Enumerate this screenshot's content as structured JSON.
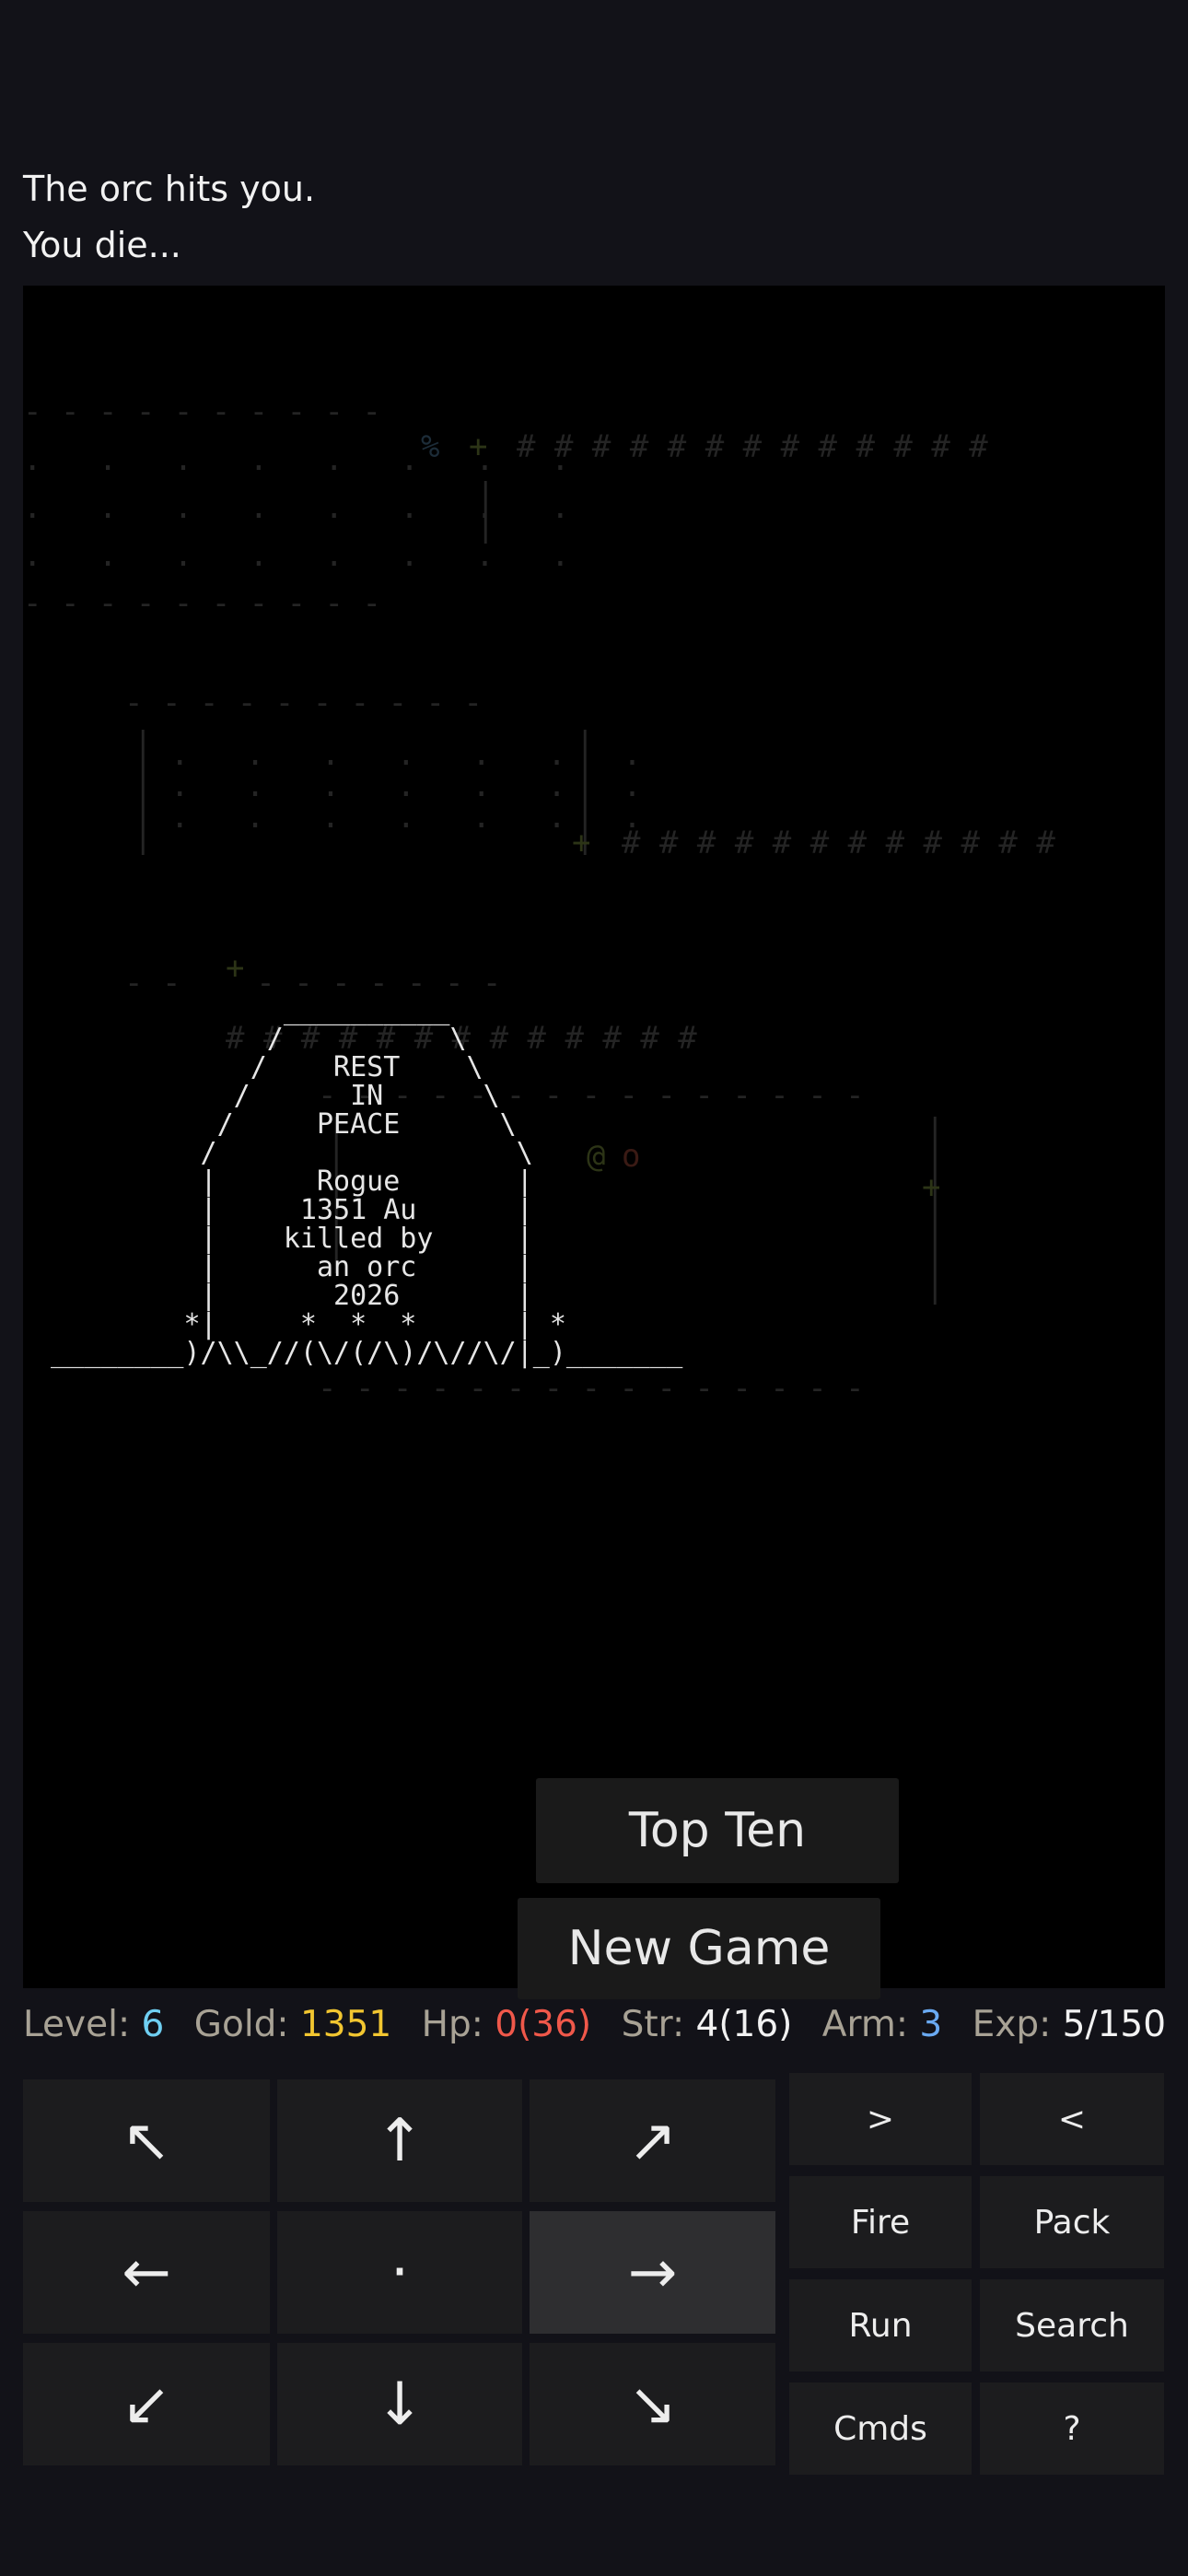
{
  "messages": [
    "The orc hits you.",
    "You die..."
  ],
  "tombstone": {
    "lines": [
      "              __________",
      "             /          \\",
      "            /    REST    \\",
      "           /      IN      \\",
      "          /     PEACE      \\",
      "         /                  \\",
      "         |      Rogue       |",
      "         |     1351 Au      |",
      "         |    killed by     |",
      "         |      an orc      |",
      "         |       2026       |",
      "        *|     *  *  *      | *",
      "________)/\\\\_//(\\/(/\\)/\\//\\/|_)_______"
    ]
  },
  "map_glyphs": {
    "gold_symbol": "%",
    "player_symbol": "@",
    "monster_symbol": "o"
  },
  "buttons": {
    "top_ten": "Top Ten",
    "new_game": "New Game"
  },
  "status": {
    "level_label": "Level:",
    "level_value": "6",
    "gold_label": "Gold:",
    "gold_value": "1351",
    "hp_label": "Hp:",
    "hp_value": "0(36)",
    "str_label": "Str:",
    "str_value": "4(16)",
    "arm_label": "Arm:",
    "arm_value": "3",
    "exp_label": "Exp:",
    "exp_value": "5/150"
  },
  "dpad": {
    "up_left": "↖",
    "up": "↑",
    "up_right": "↗",
    "left": "←",
    "center": "·",
    "right": "→",
    "down_left": "↙",
    "down": "↓",
    "down_right": "↘"
  },
  "commands": {
    "down_stairs": ">",
    "up_stairs": "<",
    "fire": "Fire",
    "pack": "Pack",
    "run": "Run",
    "search": "Search",
    "cmds": "Cmds",
    "help": "?"
  },
  "colors": {
    "background": "#121218",
    "map_bg": "#000000",
    "level": "#6fcff2",
    "gold": "#f2c630",
    "hp": "#f0584a",
    "stat_value": "#f2f2f2",
    "arm": "#6aaaf2",
    "label": "#a8a295"
  }
}
